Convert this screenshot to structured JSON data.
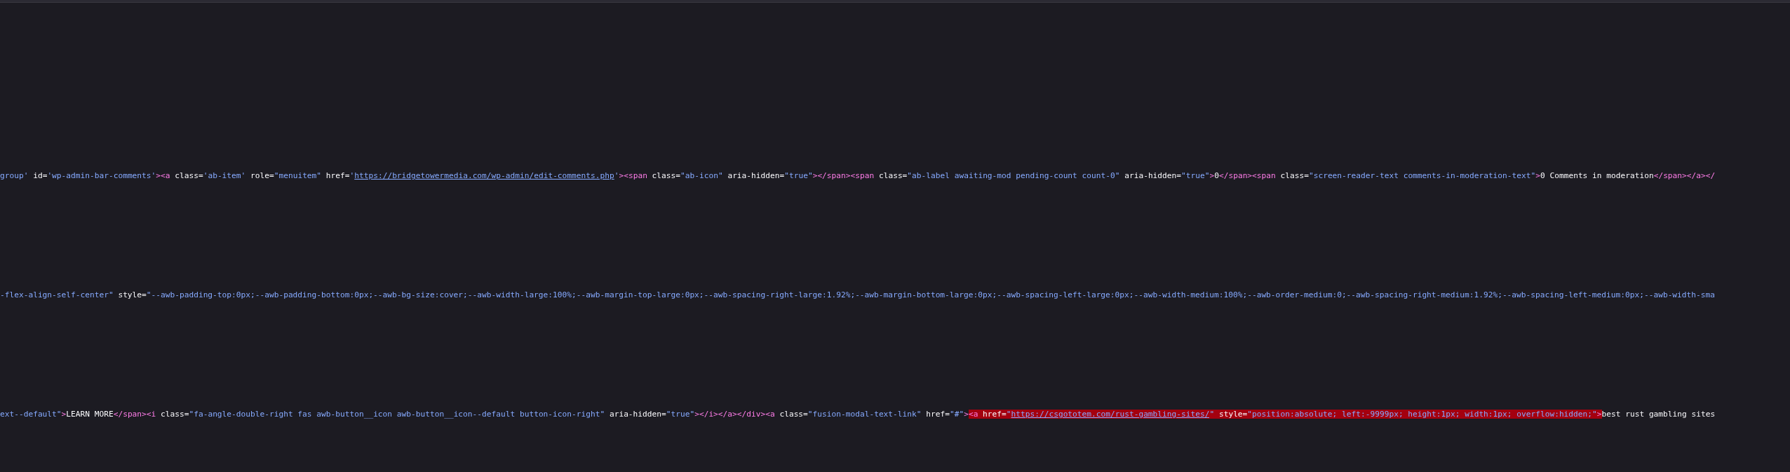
{
  "source_lines": [
    {
      "tokens": [
        {
          "kind": "value",
          "text": "group'",
          "flagged": false
        },
        {
          "kind": "attr",
          "text": " id=",
          "flagged": false
        },
        {
          "kind": "value",
          "text": "'wp-admin-bar-comments'",
          "flagged": false
        },
        {
          "kind": "tag",
          "text": "><a",
          "flagged": false
        },
        {
          "kind": "attr",
          "text": " class=",
          "flagged": false
        },
        {
          "kind": "value",
          "text": "'ab-item'",
          "flagged": false
        },
        {
          "kind": "attr",
          "text": " role=",
          "flagged": false
        },
        {
          "kind": "value",
          "text": "\"menuitem\"",
          "flagged": false
        },
        {
          "kind": "attr",
          "text": " href=",
          "flagged": false
        },
        {
          "kind": "value",
          "text": "'",
          "flagged": false
        },
        {
          "kind": "link",
          "text": "https://bridgetowermedia.com/wp-admin/edit-comments.php",
          "flagged": false
        },
        {
          "kind": "value",
          "text": "'",
          "flagged": false
        },
        {
          "kind": "tag",
          "text": "><span",
          "flagged": false
        },
        {
          "kind": "attr",
          "text": " class=",
          "flagged": false
        },
        {
          "kind": "value",
          "text": "\"ab-icon\"",
          "flagged": false
        },
        {
          "kind": "attr",
          "text": " aria-hidden=",
          "flagged": false
        },
        {
          "kind": "value",
          "text": "\"true\"",
          "flagged": false
        },
        {
          "kind": "tag",
          "text": "></span><span",
          "flagged": false
        },
        {
          "kind": "attr",
          "text": " class=",
          "flagged": false
        },
        {
          "kind": "value",
          "text": "\"ab-label awaiting-mod pending-count count-0\"",
          "flagged": false
        },
        {
          "kind": "attr",
          "text": " aria-hidden=",
          "flagged": false
        },
        {
          "kind": "value",
          "text": "\"true\"",
          "flagged": false
        },
        {
          "kind": "tag",
          "text": ">",
          "flagged": false
        },
        {
          "kind": "text",
          "text": "0",
          "flagged": false
        },
        {
          "kind": "tag",
          "text": "</span><span",
          "flagged": false
        },
        {
          "kind": "attr",
          "text": " class=",
          "flagged": false
        },
        {
          "kind": "value",
          "text": "\"screen-reader-text comments-in-moderation-text\"",
          "flagged": false
        },
        {
          "kind": "tag",
          "text": ">",
          "flagged": false
        },
        {
          "kind": "text",
          "text": "0 Comments in moderation",
          "flagged": false
        },
        {
          "kind": "tag",
          "text": "</span></a></",
          "flagged": false
        }
      ]
    },
    {
      "tokens": [
        {
          "kind": "value",
          "text": "-flex-align-self-center\"",
          "flagged": false
        },
        {
          "kind": "attr",
          "text": " style=",
          "flagged": false
        },
        {
          "kind": "value",
          "text": "\"--awb-padding-top:0px;--awb-padding-bottom:0px;--awb-bg-size:cover;--awb-width-large:100%;--awb-margin-top-large:0px;--awb-spacing-right-large:1.92%;--awb-margin-bottom-large:0px;--awb-spacing-left-large:0px;--awb-width-medium:100%;--awb-order-medium:0;--awb-spacing-right-medium:1.92%;--awb-spacing-left-medium:0px;--awb-width-sma",
          "flagged": false
        }
      ]
    },
    {
      "tokens": [
        {
          "kind": "value",
          "text": "ext--default\"",
          "flagged": false
        },
        {
          "kind": "tag",
          "text": ">",
          "flagged": false
        },
        {
          "kind": "text",
          "text": "LEARN MORE",
          "flagged": false
        },
        {
          "kind": "tag",
          "text": "</span><i",
          "flagged": false
        },
        {
          "kind": "attr",
          "text": " class=",
          "flagged": false
        },
        {
          "kind": "value",
          "text": "\"fa-angle-double-right fas awb-button__icon awb-button__icon--default button-icon-right\"",
          "flagged": false
        },
        {
          "kind": "attr",
          "text": " aria-hidden=",
          "flagged": false
        },
        {
          "kind": "value",
          "text": "\"true\"",
          "flagged": false
        },
        {
          "kind": "tag",
          "text": "></i></a></div><a",
          "flagged": false
        },
        {
          "kind": "attr",
          "text": " class=",
          "flagged": false
        },
        {
          "kind": "value",
          "text": "\"fusion-modal-text-link\"",
          "flagged": false
        },
        {
          "kind": "attr",
          "text": " href=",
          "flagged": false
        },
        {
          "kind": "value",
          "text": "\"#\"",
          "flagged": false
        },
        {
          "kind": "tag",
          "text": ">",
          "flagged": false
        },
        {
          "kind": "tag",
          "text": "<a",
          "flagged": true
        },
        {
          "kind": "attr",
          "text": " href=",
          "flagged": true
        },
        {
          "kind": "value",
          "text": "\"",
          "flagged": true
        },
        {
          "kind": "link",
          "text": "https://csgototem.com/rust-gambling-sites/",
          "flagged": true
        },
        {
          "kind": "value",
          "text": "\"",
          "flagged": true
        },
        {
          "kind": "attr",
          "text": " style=",
          "flagged": true
        },
        {
          "kind": "value",
          "text": "\"position:absolute; left:-9999px; height:1px; width:1px; overflow:hidden;\"",
          "flagged": true
        },
        {
          "kind": "tag",
          "text": ">",
          "flagged": true
        },
        {
          "kind": "text",
          "text": "best rust gambling sites",
          "flagged": false
        }
      ]
    }
  ]
}
